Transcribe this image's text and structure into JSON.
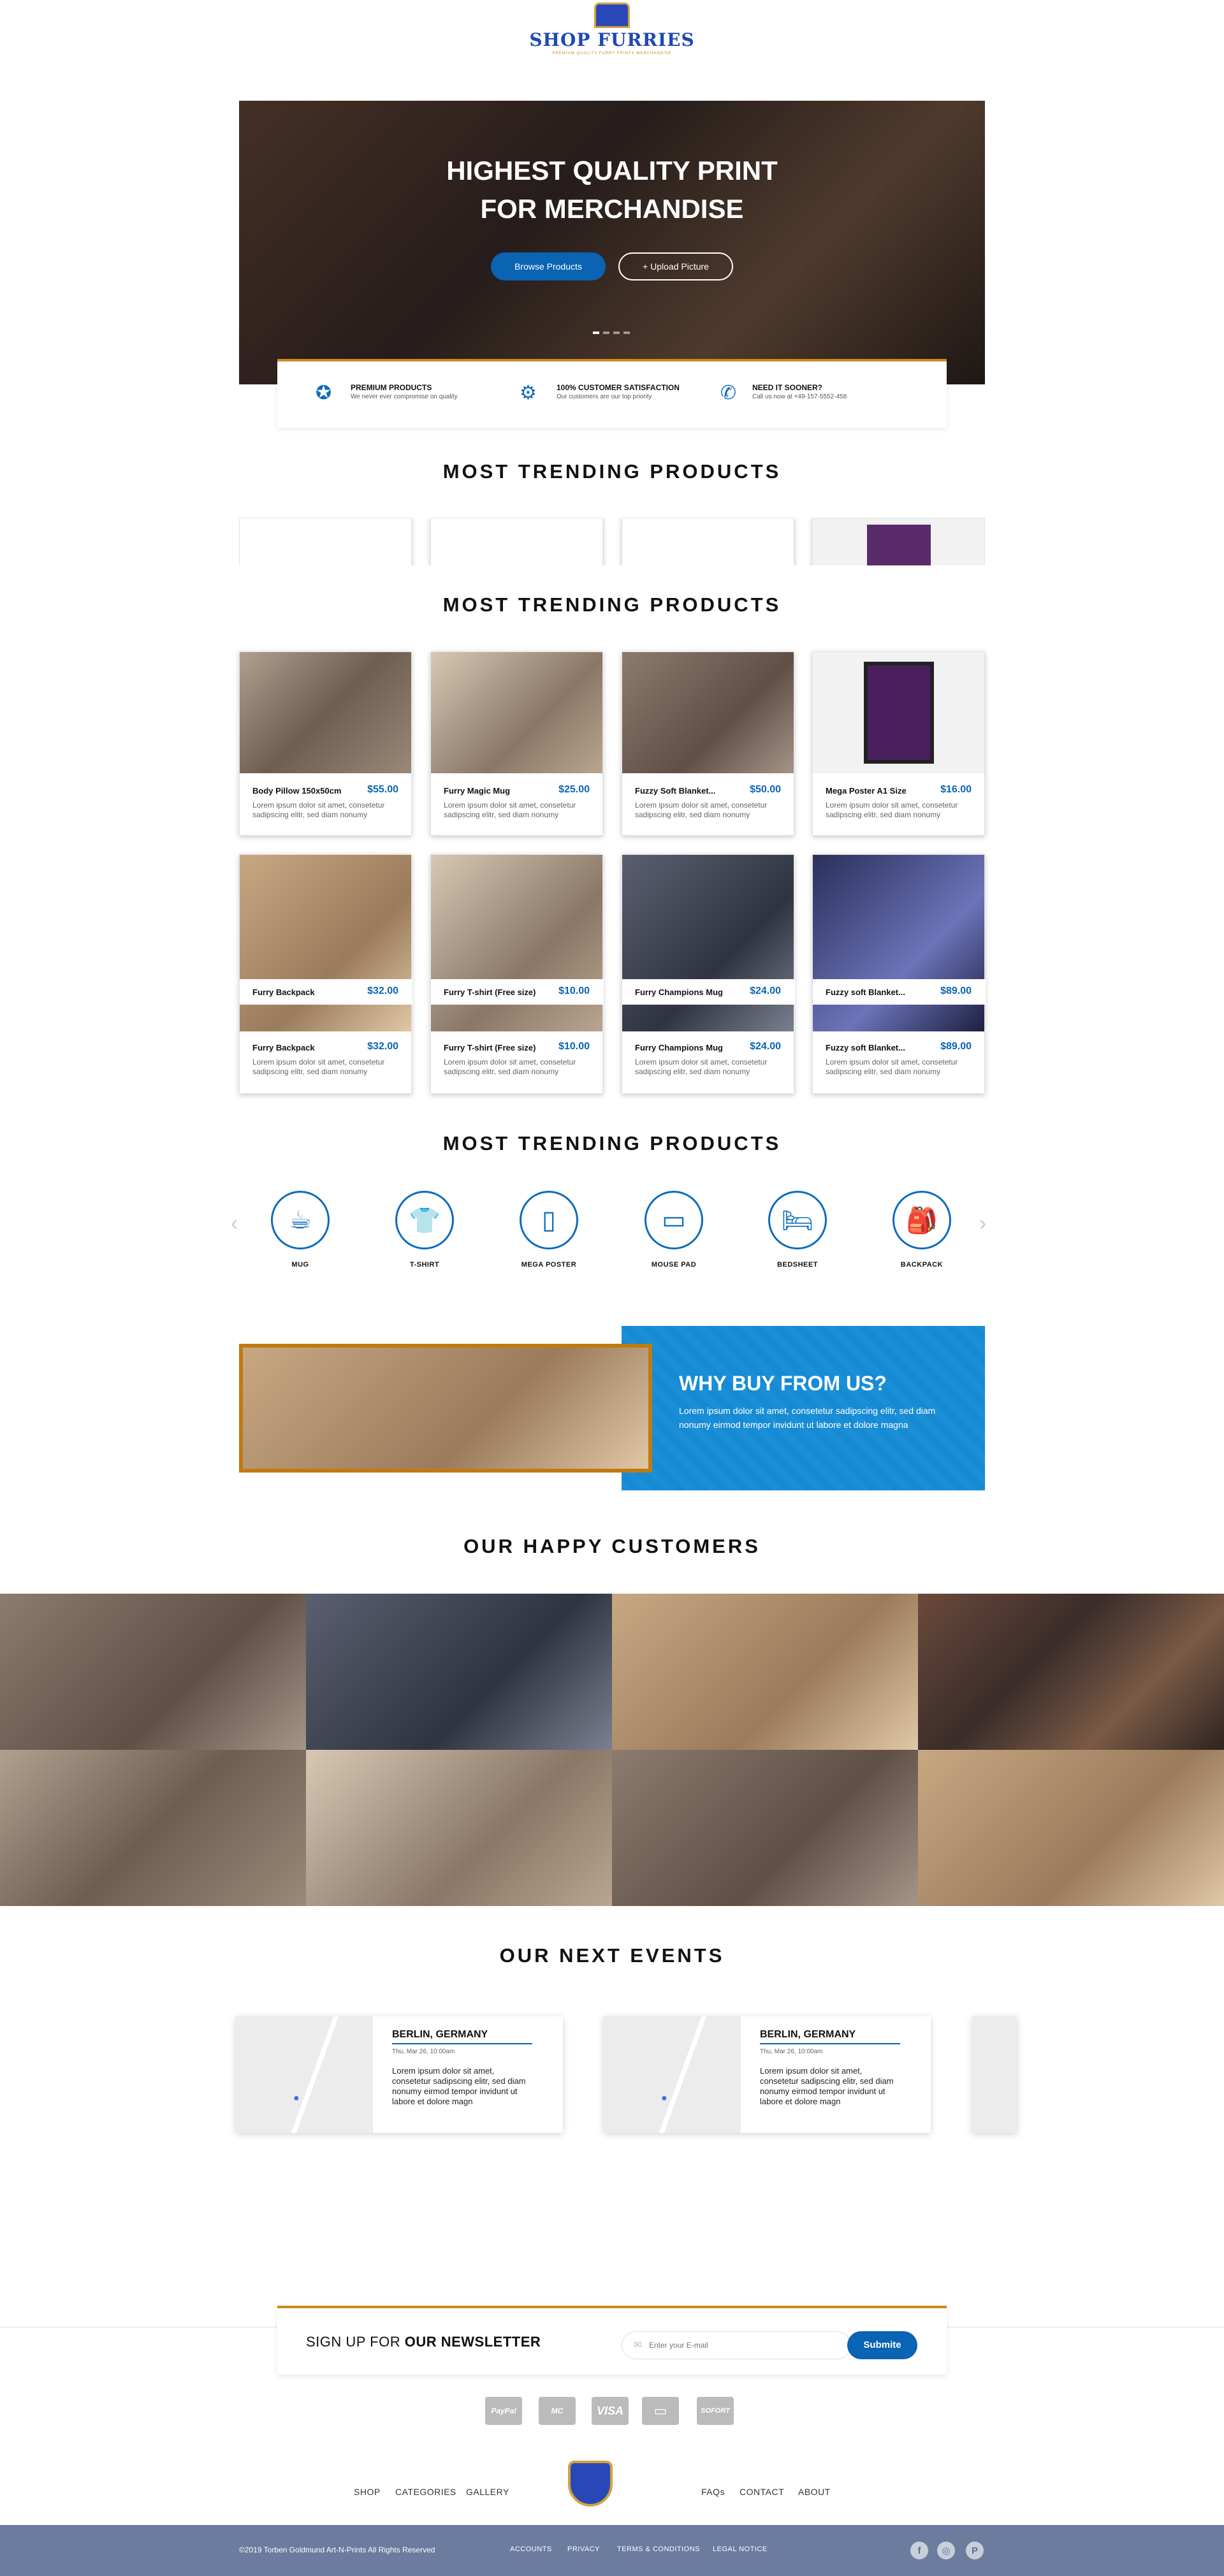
{
  "brand": {
    "name": "SHOP FURRIES",
    "tagline": "PREMIUM QUALITY FURRY PRINTS MERCHANDISE"
  },
  "hero": {
    "title_line1": "HIGHEST QUALITY PRINT",
    "title_line2": "FOR MERCHANDISE",
    "browse_label": "Browse Products",
    "upload_label": "+ Upload Picture",
    "slide_count": 4,
    "active_slide": 1
  },
  "features": [
    {
      "icon": "award-icon",
      "title": "PREMIUM PRODUCTS",
      "text": "We never ever compromise on quality"
    },
    {
      "icon": "satisfaction-icon",
      "title": "100% CUSTOMER SATISFACTION",
      "text": "Our customers are our top priority"
    },
    {
      "icon": "phone-icon",
      "title": "NEED IT SOONER?",
      "text": "Call us now at +49-157-5552-458"
    }
  ],
  "trending": {
    "title": "MOST TRENDING PRODUCTS",
    "products": [
      {
        "name": "Body Pillow 150x50cm",
        "price": "$55.00",
        "desc": "Lorem ipsum dolor sit amet, consetetur sadipscing elitr, sed diam nonumy"
      },
      {
        "name": "Furry Magic Mug",
        "price": "$25.00",
        "desc": "Lorem ipsum dolor sit amet, consetetur sadipscing elitr, sed diam nonumy"
      },
      {
        "name": "Fuzzy Soft Blanket...",
        "price": "$50.00",
        "desc": "Lorem ipsum dolor sit amet, consetetur sadipscing elitr, sed diam nonumy"
      },
      {
        "name": "Mega Poster A1 Size",
        "price": "$16.00",
        "desc": "Lorem ipsum dolor sit amet, consetetur sadipscing elitr, sed diam nonumy"
      },
      {
        "name": "Furry Backpack",
        "price": "$32.00",
        "desc": "Lorem ipsum dolor sit amet, consetetur sadipscing elitr, sed diam nonumy"
      },
      {
        "name": "Furry T-shirt (Free size)",
        "price": "$10.00",
        "desc": "Lorem ipsum dolor sit amet, consetetur sadipscing elitr, sed diam nonumy"
      },
      {
        "name": "Furry Champions Mug",
        "price": "$24.00",
        "desc": "Lorem ipsum dolor sit amet, consetetur sadipscing elitr, sed diam nonumy"
      },
      {
        "name": "Fuzzy soft Blanket...",
        "price": "$89.00",
        "desc": "Lorem ipsum dolor sit amet, consetetur sadipscing elitr, sed diam nonumy"
      }
    ]
  },
  "categories": [
    {
      "label": "MUG",
      "icon": "mug-icon",
      "glyph": "☕"
    },
    {
      "label": "T-SHIRT",
      "icon": "tshirt-icon",
      "glyph": "👕"
    },
    {
      "label": "MEGA POSTER",
      "icon": "poster-icon",
      "glyph": "▯"
    },
    {
      "label": "MOUSE PAD",
      "icon": "mousepad-icon",
      "glyph": "▭"
    },
    {
      "label": "BEDSHEET",
      "icon": "bed-icon",
      "glyph": "🛏"
    },
    {
      "label": "BACKPACK",
      "icon": "backpack-icon",
      "glyph": "🎒"
    }
  ],
  "why": {
    "title": "WHY BUY FROM US?",
    "text": "Lorem ipsum dolor sit amet, consetetur sadipscing elitr, sed diam nonumy eirmod tempor invidunt ut labore et dolore magna"
  },
  "customers": {
    "title": "OUR HAPPY CUSTOMERS"
  },
  "events": {
    "title": "OUR NEXT EVENTS",
    "items": [
      {
        "city": "BERLIN, GERMANY",
        "date": "Thu, Mar 26, 10:00am",
        "text": "Lorem ipsum dolor sit amet, consetetur sadipscing elitr, sed diam nonumy eirmod tempor invidunt ut labore et dolore magn"
      },
      {
        "city": "BERLIN, GERMANY",
        "date": "Thu, Mar 26, 10:00am",
        "text": "Lorem ipsum dolor sit amet, consetetur sadipscing elitr, sed diam nonumy eirmod tempor invidunt ut labore et dolore magn"
      }
    ]
  },
  "newsletter": {
    "prefix": "SIGN UP FOR ",
    "bold": "OUR NEWSLETTER",
    "placeholder": "Enter your E-mail",
    "button": "Submite"
  },
  "payments": [
    "PayPal",
    "MC",
    "VISA",
    "▭",
    "SOFORT"
  ],
  "footer": {
    "nav_left": [
      "SHOP",
      "CATEGORIES",
      "GALLERY"
    ],
    "nav_right": [
      "FAQs",
      "CONTACT",
      "ABOUT"
    ],
    "copyright": "©2019 Torben Goldmund Art-N-Prints All Rights Reserved",
    "links": [
      "ACCOUNTS",
      "PRIVACY",
      "TERMS & CONDITIONS",
      "LEGAL NOTICE"
    ],
    "social": [
      "f",
      "◎",
      "P"
    ]
  },
  "colors": {
    "accent": "#0a63b3",
    "gold": "#c98a1c",
    "footer_bg": "#6b7c9e"
  }
}
